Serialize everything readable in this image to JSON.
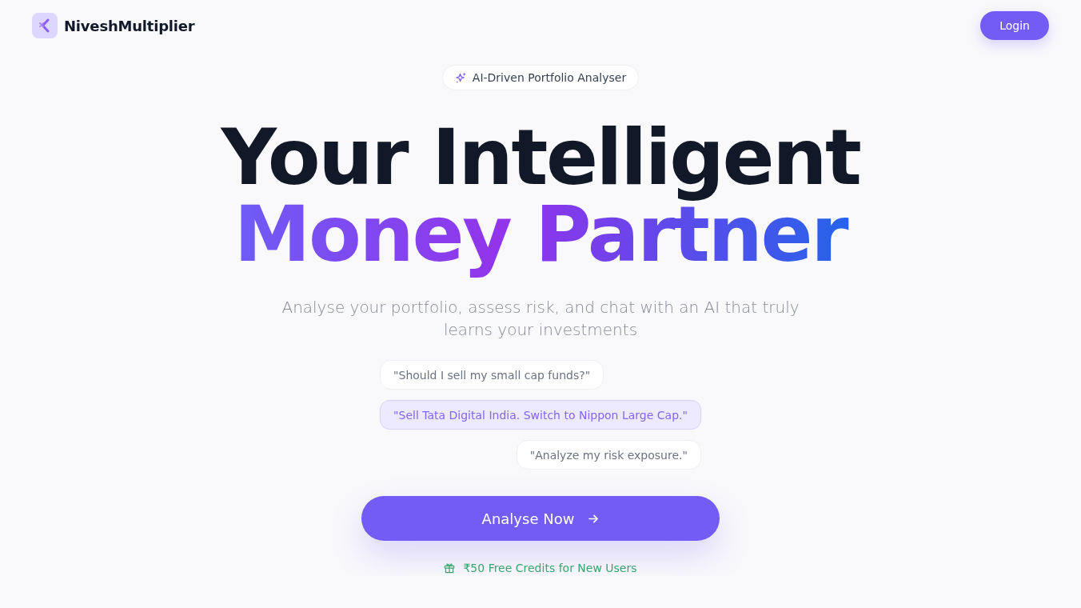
{
  "brand": {
    "name": "NiveshMultiplier"
  },
  "nav": {
    "login_button": "Login"
  },
  "hero": {
    "badge": "AI-Driven Portfolio Analyser",
    "headline_line_1": "Your Intelligent",
    "headline_line_2": "Money Partner",
    "subtitle": "Analyse your portfolio, assess risk, and chat with an AI that truly learns your investments"
  },
  "chat_examples": [
    {
      "text": "\"Should I sell my small cap funds?\"",
      "kind": "question"
    },
    {
      "text": "\"Sell Tata Digital India. Switch to Nippon Large Cap.\"",
      "kind": "answer"
    },
    {
      "text": "\"Analyze my risk exposure.\"",
      "kind": "request"
    }
  ],
  "cta_button": "Analyse Now",
  "credits_note": "₹50 Free Credits for New Users"
}
